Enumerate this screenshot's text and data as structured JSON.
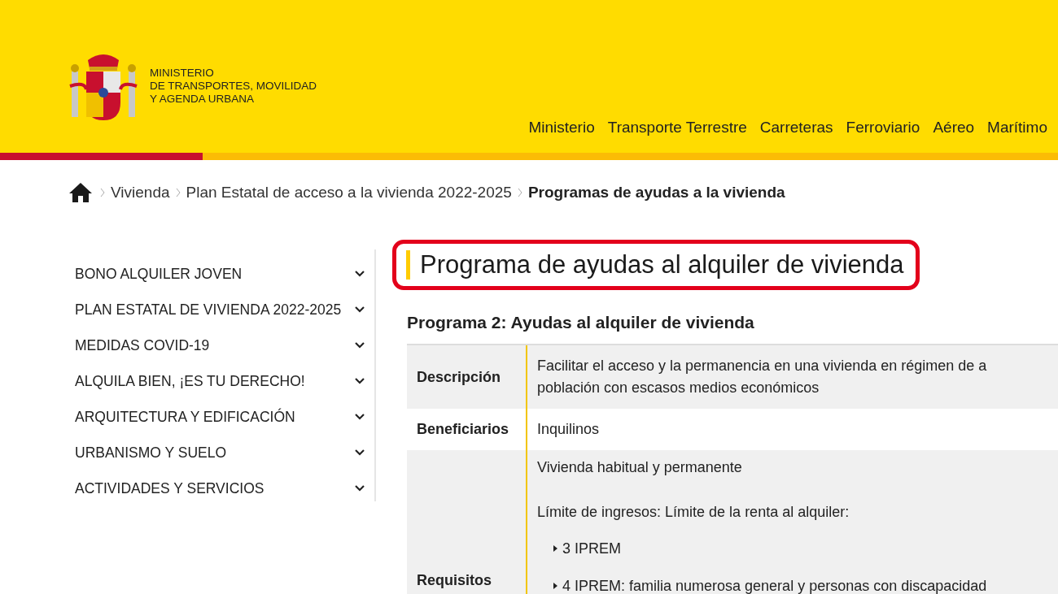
{
  "header": {
    "ministry": [
      "MINISTERIO",
      "DE TRANSPORTES, MOVILIDAD",
      "Y AGENDA URBANA"
    ],
    "nav": [
      {
        "label": "Ministerio"
      },
      {
        "label": "Transporte Terrestre"
      },
      {
        "label": "Carreteras"
      },
      {
        "label": "Ferroviario"
      },
      {
        "label": "Aéreo"
      },
      {
        "label": "Marítimo"
      }
    ]
  },
  "breadcrumb": [
    {
      "label": "Vivienda",
      "current": false
    },
    {
      "label": "Plan Estatal de acceso a la vivienda 2022-2025",
      "current": false
    },
    {
      "label": "Programas de ayudas a la vivienda",
      "current": true
    }
  ],
  "sidebar": {
    "items": [
      {
        "label": "BONO ALQUILER JOVEN",
        "expanded": false
      },
      {
        "label": "PLAN ESTATAL DE VIVIENDA 2022-2025",
        "expanded": false
      },
      {
        "label": "MEDIDAS COVID-19",
        "expanded": false
      },
      {
        "label": "ALQUILA BIEN, ¡ES TU DERECHO!",
        "expanded": false
      },
      {
        "label": "ARQUITECTURA Y EDIFICACIÓN",
        "expanded": false
      },
      {
        "label": "URBANISMO Y SUELO",
        "expanded": false
      },
      {
        "label": "ACTIVIDADES Y SERVICIOS",
        "expanded": false
      }
    ]
  },
  "content": {
    "title": "Programa de ayudas al alquiler de vivienda",
    "title_highlighted": true,
    "subtitle": "Programa 2: Ayudas al alquiler de vivienda",
    "table": {
      "rows": [
        {
          "label": "Descripción",
          "lines": [
            "Facilitar el acceso y la permanencia en una vivienda en régimen de a",
            "población con escasos medios económicos"
          ],
          "bullets": []
        },
        {
          "label": "Beneficiarios",
          "lines": [
            "Inquilinos"
          ],
          "bullets": []
        },
        {
          "label": "Requisitos",
          "lines": [
            "Vivienda habitual y permanente",
            "Límite de ingresos: Límite de la renta al alquiler:"
          ],
          "bullets": [
            "3 IPREM",
            "4 IPREM: familia numerosa general y personas con discapacidad"
          ]
        }
      ]
    }
  }
}
